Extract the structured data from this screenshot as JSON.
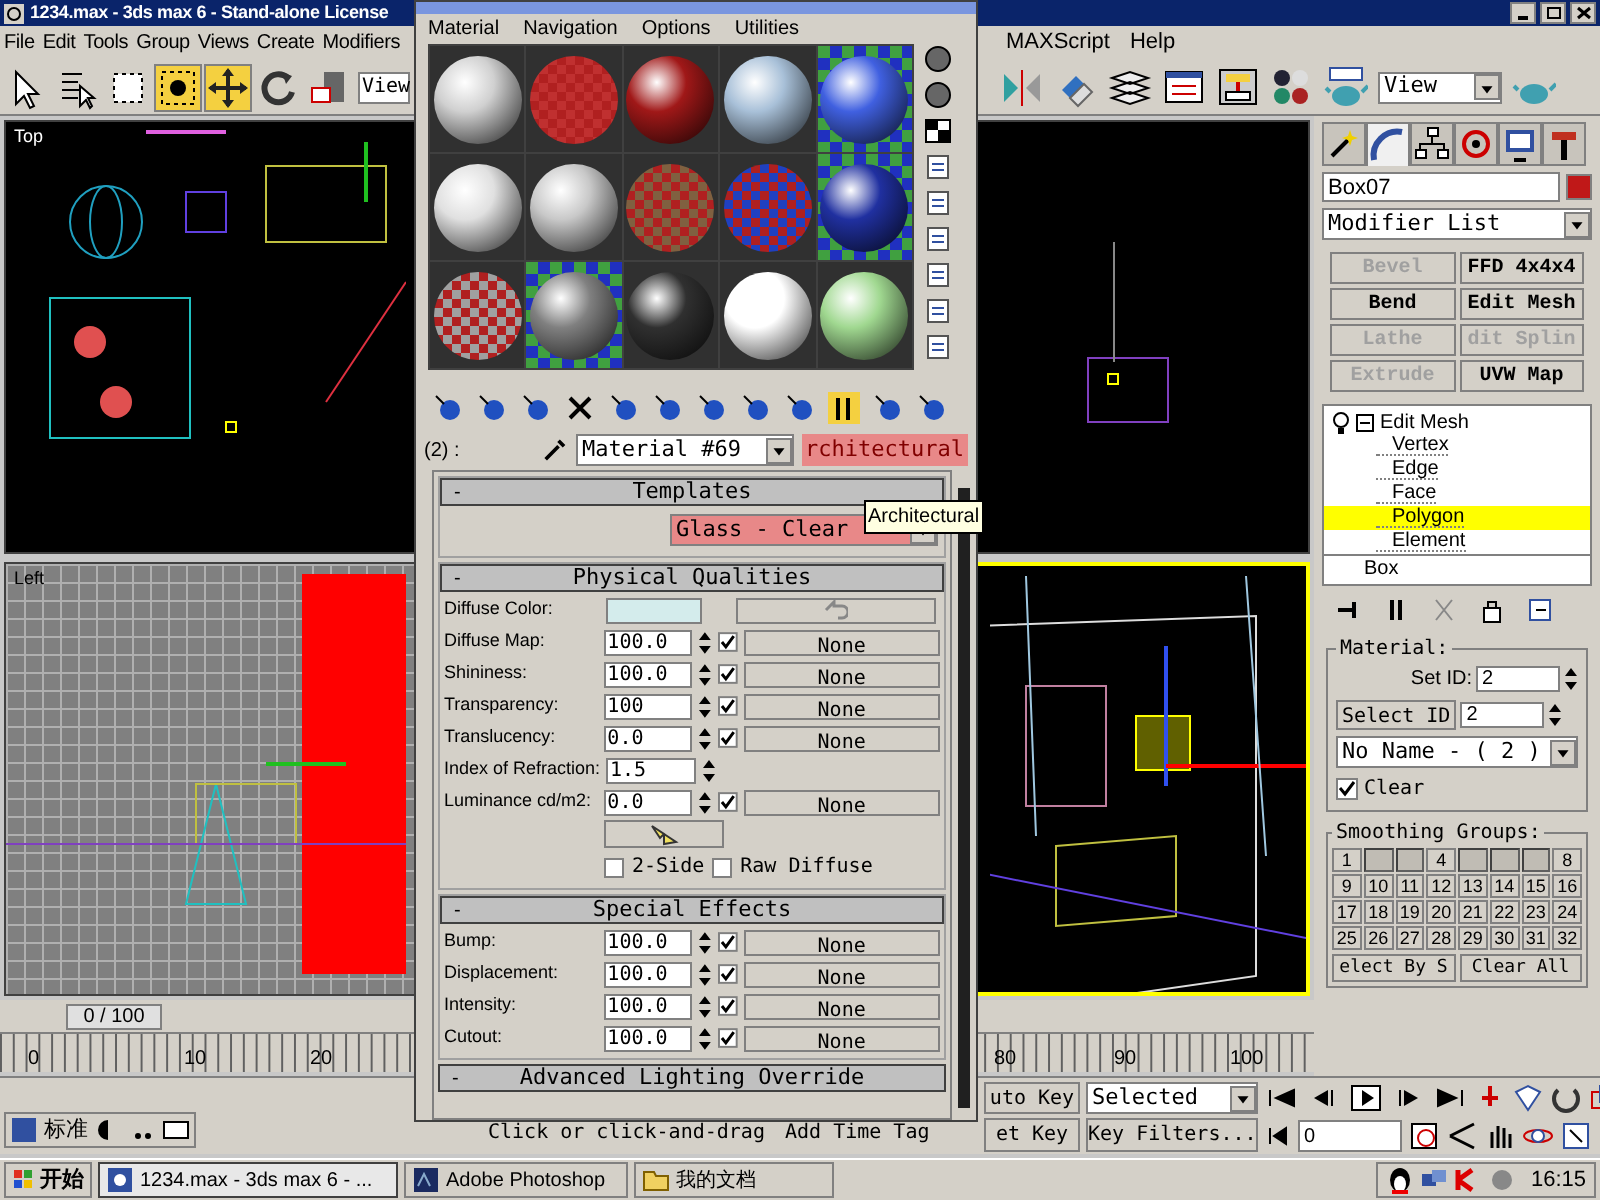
{
  "window": {
    "title": "1234.max - 3ds max 6 - Stand-alone License"
  },
  "menu": {
    "left": [
      "File",
      "Edit",
      "Tools",
      "Group",
      "Views",
      "Create",
      "Modifiers"
    ],
    "right": [
      "MAXScript",
      "Help"
    ]
  },
  "toolbar": {
    "view_left": "View",
    "view_right": "View"
  },
  "viewports": [
    {
      "label": "Top",
      "active": false,
      "kind": "top"
    },
    {
      "active": false,
      "kind": "front"
    },
    {
      "label": "Left",
      "active": false,
      "kind": "left"
    },
    {
      "active": true,
      "kind": "perspective"
    }
  ],
  "time_slider": {
    "position": "0 / 100",
    "level": 0
  },
  "ruler_labels": [
    "0",
    "10",
    "20",
    "80",
    "90",
    "100"
  ],
  "ime_bar": {
    "label": "标准"
  },
  "prompt": {
    "text": "Click or click-and-drag",
    "button": "Add Time Tag"
  },
  "animation": {
    "auto_key": "uto Key",
    "selection": "Selected",
    "set_key": "et Key",
    "key_filters": "Key Filters...",
    "frame": "0"
  },
  "command_panel": {
    "tabs": [
      {
        "selected": false
      },
      {
        "selected": true
      },
      {
        "selected": false
      },
      {
        "selected": false
      },
      {
        "selected": false
      },
      {
        "selected": false
      }
    ],
    "object_name": "Box07",
    "object_swatch": {
      "color": "#c01818"
    },
    "modifier_list": "Modifier List",
    "modifier_buttons": [
      {
        "label": "Bevel",
        "disabled": true
      },
      {
        "label": "FFD 4x4x4",
        "disabled": false
      },
      {
        "label": "Bend",
        "disabled": false
      },
      {
        "label": "Edit Mesh",
        "disabled": false
      },
      {
        "label": "Lathe",
        "disabled": true
      },
      {
        "label": "dit Splin",
        "disabled": true
      },
      {
        "label": "Extrude",
        "disabled": true
      },
      {
        "label": "UVW Map",
        "disabled": false
      }
    ],
    "stack": [
      {
        "label": "Edit Mesh",
        "expanded": true,
        "selected": false,
        "children": [
          {
            "label": "Vertex",
            "selected": false
          },
          {
            "label": "Edge",
            "selected": false
          },
          {
            "label": "Face",
            "selected": false
          },
          {
            "label": "Polygon",
            "selected": true
          },
          {
            "label": "Element",
            "selected": false
          }
        ]
      },
      {
        "label": "Box",
        "selected": false
      }
    ],
    "material": {
      "title": "Material:",
      "set_id_label": "Set ID:",
      "set_id": "2",
      "select_id": "Select ID",
      "select_id_value": "2",
      "name": "No Name - ( 2 )",
      "clear": {
        "label": "Clear",
        "checked": true
      }
    },
    "smoothing": {
      "title": "Smoothing Groups:",
      "buttons": [
        {
          "kind": "numbered",
          "label": "1"
        },
        {
          "kind": "blank"
        },
        {
          "kind": "blank"
        },
        {
          "kind": "numbered",
          "label": "4"
        },
        {
          "kind": "blank"
        },
        {
          "kind": "blank"
        },
        {
          "kind": "blank"
        },
        {
          "kind": "numbered",
          "label": "8"
        },
        {
          "kind": "numbered",
          "label": "9"
        },
        {
          "kind": "numbered",
          "label": "10"
        },
        {
          "kind": "numbered",
          "label": "11"
        },
        {
          "kind": "numbered",
          "label": "12"
        },
        {
          "kind": "numbered",
          "label": "13"
        },
        {
          "kind": "numbered",
          "label": "14"
        },
        {
          "kind": "numbered",
          "label": "15"
        },
        {
          "kind": "numbered",
          "label": "16"
        },
        {
          "kind": "numbered",
          "label": "17"
        },
        {
          "kind": "numbered",
          "label": "18"
        },
        {
          "kind": "numbered",
          "label": "19"
        },
        {
          "kind": "numbered",
          "label": "20"
        },
        {
          "kind": "numbered",
          "label": "21"
        },
        {
          "kind": "numbered",
          "label": "22"
        },
        {
          "kind": "numbered",
          "label": "23"
        },
        {
          "kind": "numbered",
          "label": "24"
        },
        {
          "kind": "numbered",
          "label": "25"
        },
        {
          "kind": "numbered",
          "label": "26"
        },
        {
          "kind": "numbered",
          "label": "27"
        },
        {
          "kind": "numbered",
          "label": "28"
        },
        {
          "kind": "numbered",
          "label": "29"
        },
        {
          "kind": "numbered",
          "label": "30"
        },
        {
          "kind": "numbered",
          "label": "31"
        },
        {
          "kind": "numbered",
          "label": "32"
        }
      ],
      "select_by": "elect By S",
      "clear_all": "Clear All"
    }
  },
  "material_editor": {
    "menu": [
      "Material",
      "Navigation",
      "Options",
      "Utilities"
    ],
    "slots": [
      {
        "kind": "plain",
        "color": "#d0d0d0"
      },
      {
        "kind": "checker",
        "color": "#c03030"
      },
      {
        "kind": "plain",
        "color": "#a01818"
      },
      {
        "kind": "plain",
        "color": "#a8c0d8"
      },
      {
        "kind": "glass",
        "color": "#4060e0"
      },
      {
        "kind": "plain",
        "color": "#e0e0e0"
      },
      {
        "kind": "plain",
        "color": "#c8c8c8"
      },
      {
        "kind": "checker",
        "color": "#806040"
      },
      {
        "kind": "checker",
        "color": "#2040c0"
      },
      {
        "kind": "glass",
        "color": "#2030a0"
      },
      {
        "kind": "checker",
        "color": "#a0a0a0"
      },
      {
        "kind": "glass",
        "color": "#808080"
      },
      {
        "kind": "plain",
        "color": "#303030"
      },
      {
        "kind": "plain",
        "color": "#ffffff"
      },
      {
        "kind": "plain",
        "color": "#a0d890"
      }
    ],
    "slot_label": "(2) :",
    "material_name": "Material #69",
    "material_type": "rchitectural",
    "tooltip": "Architectural",
    "rollouts": [
      {
        "toggle": "-",
        "title": "Templates",
        "kind": "templates",
        "template": "Glass - Clear"
      },
      {
        "toggle": "-",
        "title": "Physical Qualities",
        "kind": "params",
        "params": [
          {
            "kind": "color",
            "label": "Diffuse Color:",
            "color": "#d4ecec"
          },
          {
            "kind": "map",
            "label": "Diffuse Map:",
            "value": "100.0",
            "enabled": true,
            "map": "None"
          },
          {
            "kind": "map",
            "label": "Shininess:",
            "value": "100.0",
            "enabled": true,
            "map": "None"
          },
          {
            "kind": "map",
            "label": "Transparency:",
            "value": "100",
            "enabled": true,
            "map": "None"
          },
          {
            "kind": "map",
            "label": "Translucency:",
            "value": "0.0",
            "enabled": true,
            "map": "None"
          },
          {
            "kind": "spinner",
            "label": "Index of Refraction:",
            "value": "1.5"
          },
          {
            "kind": "map",
            "label": "Luminance cd/m2:",
            "value": "0.0",
            "enabled": true,
            "map": "None"
          }
        ],
        "options": [
          {
            "label": "2-Side",
            "checked": false
          },
          {
            "label": "Raw Diffuse",
            "checked": false
          }
        ]
      },
      {
        "toggle": "-",
        "title": "Special Effects",
        "kind": "params",
        "params": [
          {
            "kind": "map",
            "label": "Bump:",
            "value": "100.0",
            "enabled": true,
            "map": "None"
          },
          {
            "kind": "map",
            "label": "Displacement:",
            "value": "100.0",
            "enabled": true,
            "map": "None"
          },
          {
            "kind": "map",
            "label": "Intensity:",
            "value": "100.0",
            "enabled": true,
            "map": "None"
          },
          {
            "kind": "map",
            "label": "Cutout:",
            "value": "100.0",
            "enabled": true,
            "map": "None"
          }
        ]
      },
      {
        "toggle": "-",
        "title": "Advanced Lighting Override",
        "kind": "collapsed"
      }
    ]
  },
  "taskbar": {
    "start": "开始",
    "tasks": [
      {
        "label": "1234.max - 3ds max 6 - ...",
        "selected": true
      },
      {
        "label": "Adobe Photoshop",
        "selected": false
      },
      {
        "label": "我的文档",
        "selected": false
      }
    ],
    "clock": "16:15"
  }
}
